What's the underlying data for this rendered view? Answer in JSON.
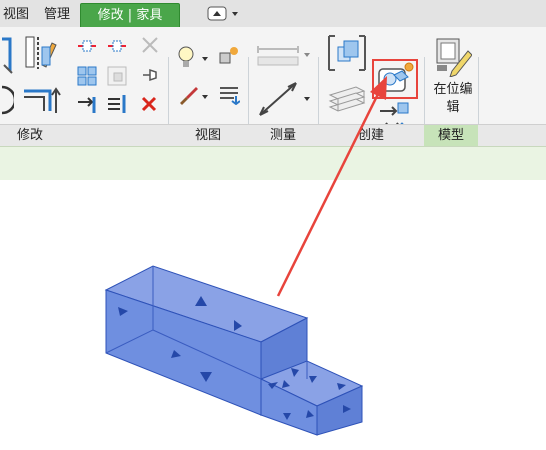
{
  "tabs": {
    "view": "视图",
    "manage": "管理",
    "modify_family": "修改 | 家具"
  },
  "panels": {
    "modify": "修改",
    "view": "视图",
    "measure": "测量",
    "create": "创建",
    "model": "模型"
  },
  "buttons": {
    "inplace_edit": "在位编辑"
  },
  "colors": {
    "context_tab": "#4aa64a",
    "model_panel": "#c7e3b9",
    "options_bar": "#eaf4e3",
    "geometry_fill": "#6f8fe0",
    "annotation_red": "#e8443c"
  }
}
